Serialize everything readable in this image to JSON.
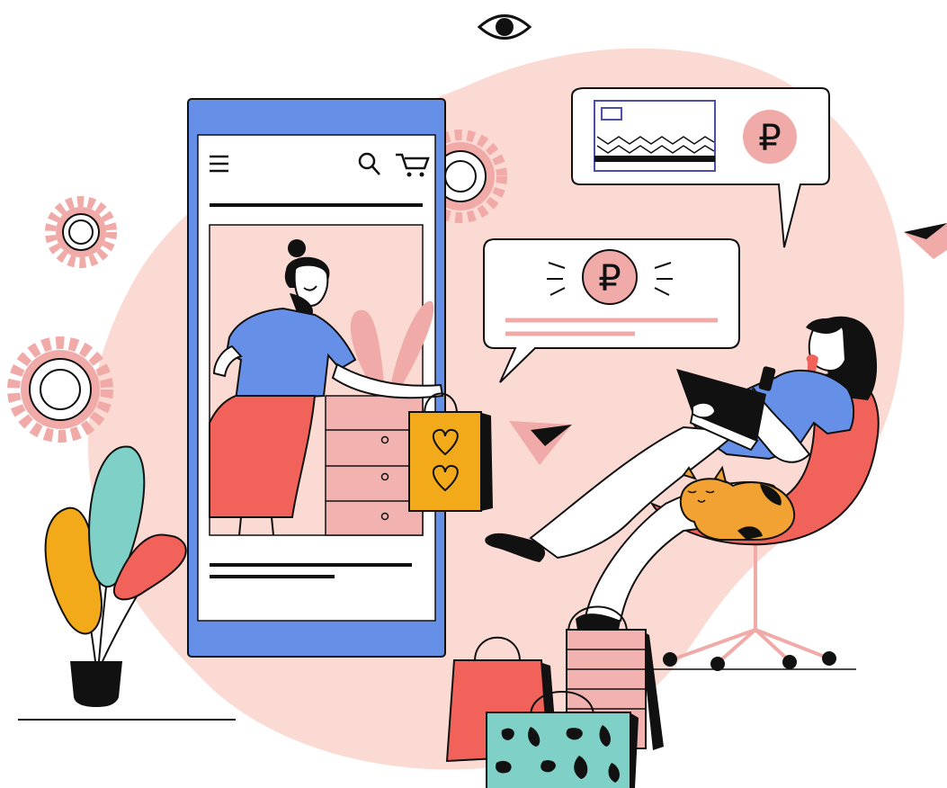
{
  "illustration": {
    "currency_symbol": "₽",
    "colors": {
      "background": "#ffffff",
      "blob": "#fbdad3",
      "phone_frame": "#6690e8",
      "phone_screen": "#ffffff",
      "ink": "#111111",
      "pink": "#f0aaa8",
      "coral": "#f0625a",
      "yellow": "#f2a91a",
      "teal": "#7fd0c6",
      "blue": "#6690e8",
      "orange_cat": "#f2a232",
      "rose_box": "#f2b3b0"
    },
    "icons": [
      "eye-icon",
      "menu-icon",
      "search-icon",
      "cart-icon",
      "ruble-icon",
      "gear-icon",
      "paper-plane-icon",
      "heart-icon",
      "credit-card-icon"
    ]
  }
}
